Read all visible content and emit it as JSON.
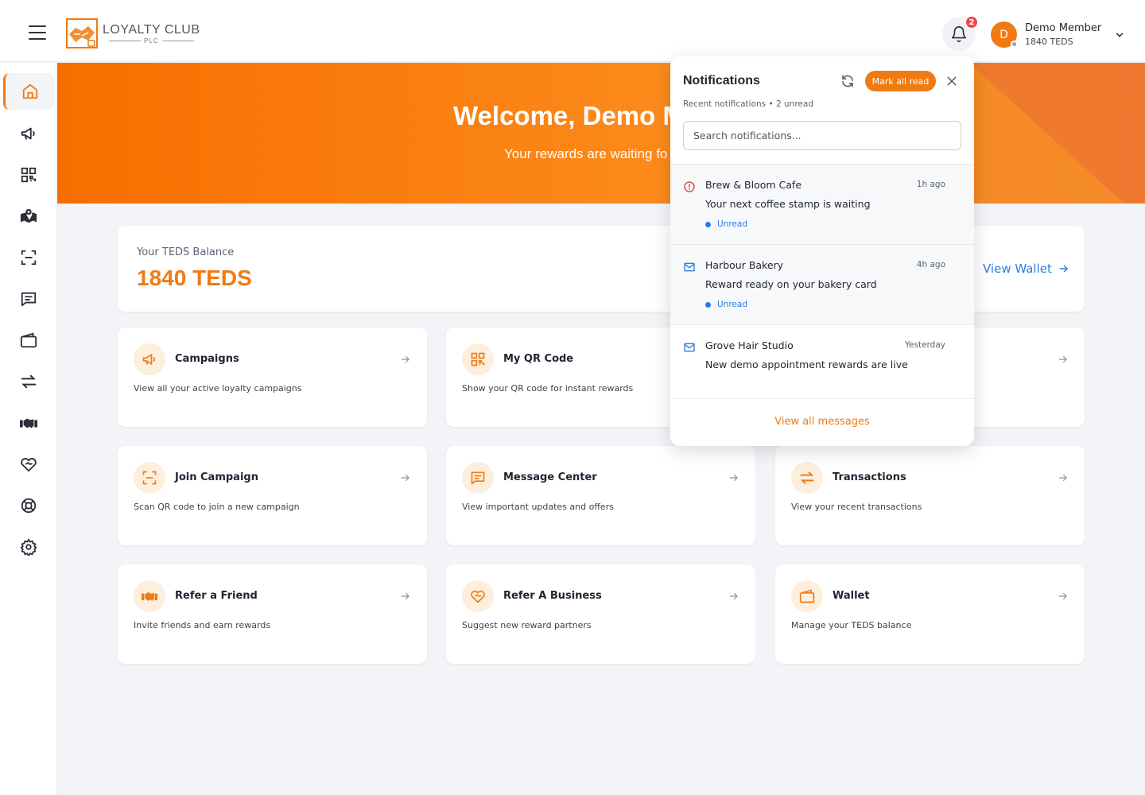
{
  "header": {
    "brand_name": "LOYALTY CLUB",
    "brand_sub": "PLC",
    "notification_count": "2",
    "user": {
      "initial": "D",
      "name": "Demo Member",
      "balance": "1840 TEDS"
    }
  },
  "sidebar": {
    "items": [
      {
        "icon": "home-icon",
        "active": true
      },
      {
        "icon": "megaphone-icon"
      },
      {
        "icon": "qr-code-icon"
      },
      {
        "icon": "map-icon"
      },
      {
        "icon": "scan-icon"
      },
      {
        "icon": "message-icon"
      },
      {
        "icon": "wallet-icon"
      },
      {
        "icon": "transfer-icon"
      },
      {
        "icon": "handshake-icon"
      },
      {
        "icon": "heart-handshake-icon"
      },
      {
        "icon": "lifebuoy-icon"
      },
      {
        "icon": "settings-icon"
      }
    ]
  },
  "hero": {
    "title": "Welcome, Demo M",
    "subtitle": "Your rewards are waiting fo"
  },
  "balance": {
    "label": "Your TEDS Balance",
    "value": "1840 TEDS",
    "link": "View Wallet"
  },
  "tiles": [
    {
      "title": "Campaigns",
      "desc": "View all your active loyalty campaigns",
      "icon": "megaphone-icon"
    },
    {
      "title": "My QR Code",
      "desc": "Show your QR code for instant rewards",
      "icon": "qr-code-icon"
    },
    {
      "title": "",
      "desc": "",
      "icon": ""
    },
    {
      "title": "Join Campaign",
      "desc": "Scan QR code to join a new campaign",
      "icon": "scan-icon"
    },
    {
      "title": "Message Center",
      "desc": "View important updates and offers",
      "icon": "message-icon"
    },
    {
      "title": "Transactions",
      "desc": "View your recent transactions",
      "icon": "transfer-icon"
    },
    {
      "title": "Refer a Friend",
      "desc": "Invite friends and earn rewards",
      "icon": "handshake-icon"
    },
    {
      "title": "Refer A Business",
      "desc": "Suggest new reward partners",
      "icon": "heart-handshake-icon"
    },
    {
      "title": "Wallet",
      "desc": "Manage your TEDS balance",
      "icon": "wallet-icon"
    }
  ],
  "notifications": {
    "title": "Notifications",
    "mark_all": "Mark all read",
    "subtitle": "Recent notifications • 2 unread",
    "search_placeholder": "Search notifications...",
    "items": [
      {
        "sender": "Brew & Bloom Cafe",
        "time": "1h ago",
        "message": "Your next coffee stamp is waiting",
        "status": "Unread",
        "icon": "alert-circle-icon"
      },
      {
        "sender": "Harbour Bakery",
        "time": "4h ago",
        "message": "Reward ready on your bakery card",
        "status": "Unread",
        "icon": "mail-icon"
      },
      {
        "sender": "Grove Hair Studio",
        "time": "Yesterday",
        "message": "New demo appointment rewards are live",
        "status": "",
        "icon": "mail-icon"
      }
    ],
    "view_all": "View all messages"
  },
  "colors": {
    "accent": "#f07b12",
    "link": "#2d7be0",
    "badge": "#e84a4a"
  }
}
